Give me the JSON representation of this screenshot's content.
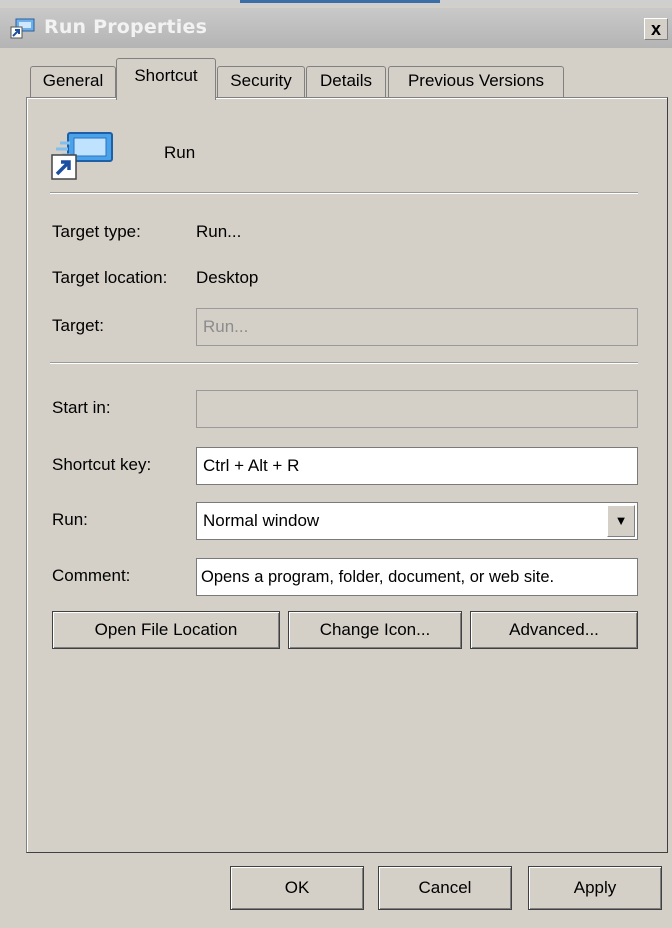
{
  "window": {
    "title": "Run Properties",
    "close_label": "x"
  },
  "tabs": [
    {
      "label": "General",
      "active": false
    },
    {
      "label": "Shortcut",
      "active": true
    },
    {
      "label": "Security",
      "active": false
    },
    {
      "label": "Details",
      "active": false
    },
    {
      "label": "Previous Versions",
      "active": false
    }
  ],
  "shortcut": {
    "name": "Run",
    "icon": "run-shortcut-icon",
    "target_type_label": "Target type:",
    "target_type_value": "Run...",
    "target_location_label": "Target location:",
    "target_location_value": "Desktop",
    "target_label": "Target:",
    "target_value": "Run...",
    "start_in_label": "Start in:",
    "start_in_value": "",
    "shortcut_key_label": "Shortcut key:",
    "shortcut_key_value": "Ctrl + Alt + R",
    "run_label": "Run:",
    "run_value": "Normal window",
    "comment_label": "Comment:",
    "comment_value": "Opens a program, folder, document, or web site.",
    "open_file_location": "Open File Location",
    "change_icon": "Change Icon...",
    "advanced": "Advanced..."
  },
  "footer": {
    "ok": "OK",
    "cancel": "Cancel",
    "apply": "Apply"
  },
  "colors": {
    "face": "#d4d0c8",
    "title_gradient_top": "#c9c9c9",
    "disabled_text": "#8c8c8c"
  }
}
